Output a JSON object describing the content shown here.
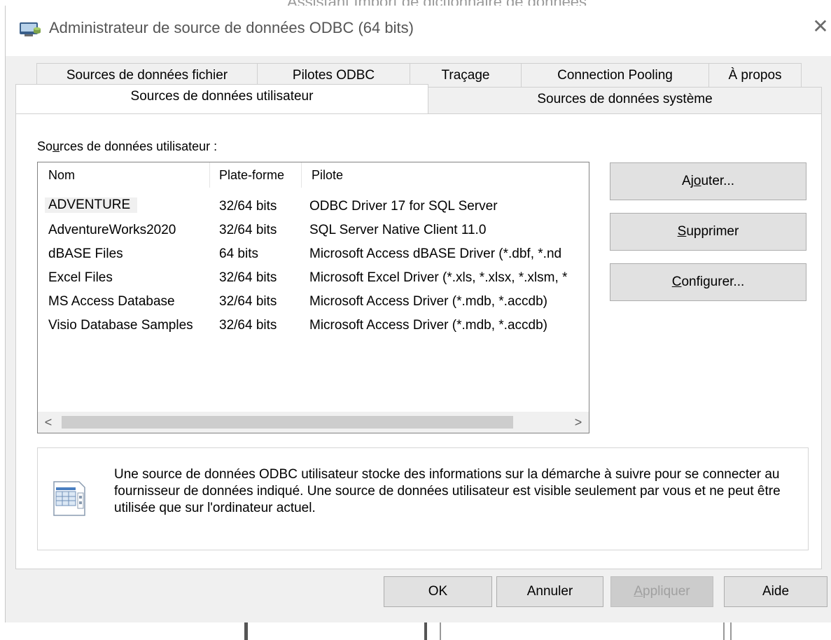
{
  "background": {
    "behind_title_text": "Assistant Import de dictionnaire de données"
  },
  "window": {
    "title": "Administrateur de source de données ODBC (64 bits)",
    "close_glyph": "✕"
  },
  "tabs": {
    "row1": [
      {
        "label": "Sources de données fichier"
      },
      {
        "label": "Pilotes ODBC"
      },
      {
        "label": "Traçage"
      },
      {
        "label": "Connection Pooling"
      },
      {
        "label": "À propos"
      }
    ],
    "row2": [
      {
        "label": "Sources de données utilisateur",
        "active": true
      },
      {
        "label": "Sources de données système",
        "active": false
      }
    ]
  },
  "panel": {
    "section_label_pre": "So",
    "section_label_mnemonic": "u",
    "section_label_post": "rces de données utilisateur :",
    "list": {
      "columns": [
        "Nom",
        "Plate-forme",
        "Pilote"
      ],
      "rows": [
        {
          "name": "ADVENTURE",
          "platform": "32/64 bits",
          "driver": "ODBC Driver 17 for SQL Server",
          "selected": true
        },
        {
          "name": "AdventureWorks2020",
          "platform": "32/64 bits",
          "driver": "SQL Server Native Client 11.0"
        },
        {
          "name": "dBASE Files",
          "platform": "64 bits",
          "driver": "Microsoft Access dBASE Driver (*.dbf, *.nd"
        },
        {
          "name": "Excel Files",
          "platform": "32/64 bits",
          "driver": "Microsoft Excel Driver (*.xls, *.xlsx, *.xlsm, *"
        },
        {
          "name": "MS Access Database",
          "platform": "32/64 bits",
          "driver": "Microsoft Access Driver (*.mdb, *.accdb)"
        },
        {
          "name": "Visio Database Samples",
          "platform": "32/64 bits",
          "driver": "Microsoft Access Driver (*.mdb, *.accdb)"
        }
      ],
      "scroll_left": "<",
      "scroll_right": ">"
    },
    "buttons": {
      "add": {
        "pre": "Aj",
        "mnemonic": "o",
        "post": "uter..."
      },
      "remove": {
        "pre": "",
        "mnemonic": "S",
        "post": "upprimer"
      },
      "configure": {
        "pre": "",
        "mnemonic": "C",
        "post": "onfigurer..."
      }
    },
    "info": {
      "icon": "datasource-icon",
      "text": "Une source de données ODBC utilisateur stocke des informations sur la démarche à suivre pour se connecter au fournisseur de données indiqué.   Une source de données utilisateur est visible seulement par vous et ne peut être utilisée que sur l'ordinateur actuel."
    }
  },
  "footer": {
    "ok": "OK",
    "cancel": "Annuler",
    "apply_mnemonic": "A",
    "apply_rest": "ppliquer",
    "help": "Aide"
  },
  "colors": {
    "dialog_bg": "#f0f0f0",
    "button_bg": "#e1e1e1",
    "button_border": "#adadad"
  }
}
